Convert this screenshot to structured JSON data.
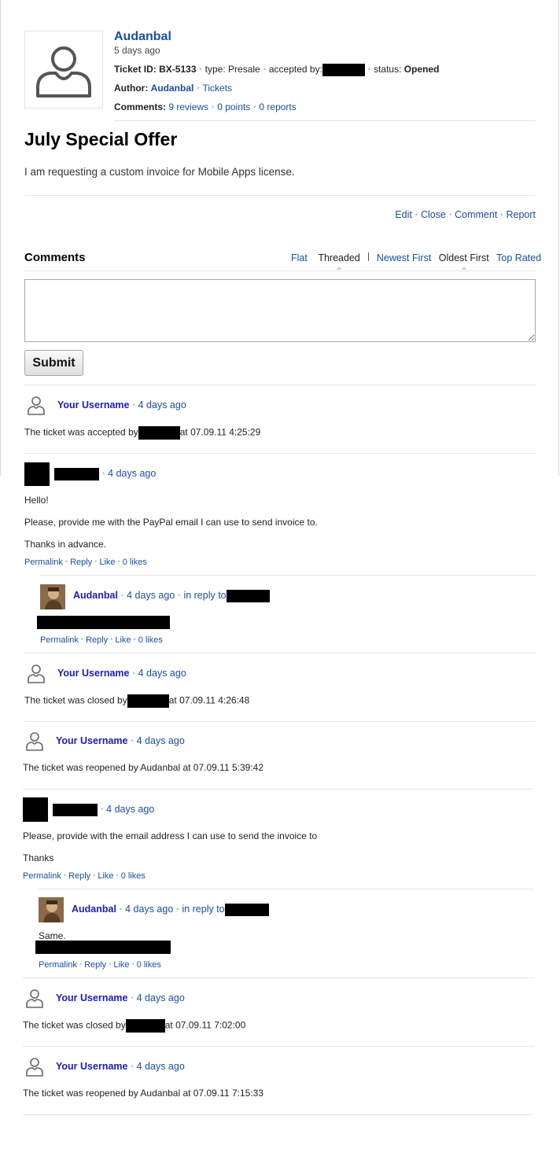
{
  "ticket": {
    "author": "Audanbal",
    "time": "5 days ago",
    "id_label": "Ticket ID:",
    "id": "BX-5133",
    "type_label": "type:",
    "type": "Presale",
    "accepted_label": "accepted by:",
    "status_label": "status:",
    "status": "Opened",
    "author_label": "Author:",
    "author_link": "Audanbal",
    "tickets_link": "Tickets",
    "comments_label": "Comments:",
    "reviews": "9 reviews",
    "points": "0 points",
    "reports": "0 reports",
    "title": "July Special Offer",
    "body": "I am requesting a custom invoice for Mobile Apps license.",
    "actions": [
      "Edit",
      "Close",
      "Comment",
      "Report"
    ]
  },
  "comments_section": {
    "title": "Comments",
    "view_flat": "Flat",
    "view_threaded": "Threaded",
    "sort_newest": "Newest First",
    "sort_oldest": "Oldest First",
    "sort_top": "Top Rated",
    "submit_label": "Submit"
  },
  "common": {
    "your_username": "Your Username",
    "four_days": "4 days ago",
    "permalink": "Permalink",
    "reply": "Reply",
    "like": "Like",
    "likes": "0 likes",
    "in_reply_to": "in reply to",
    "audanbal": "Audanbal"
  },
  "comments": {
    "c1_text_a": "The ticket was accepted by",
    "c1_text_b": "at 07.09.11 4:25:29",
    "c2_l1": "Hello!",
    "c2_l2": "Please, provide me with the PayPal email I can use to send invoice to.",
    "c2_l3": "Thanks in advance.",
    "c4_text_a": "The ticket was closed by",
    "c4_text_b": "at 07.09.11 4:26:48",
    "c5_text": "The ticket was reopened by Audanbal at 07.09.11 5:39:42",
    "c6_l1": "Please, provide with the email address I can use to send the invoice to",
    "c6_l2": "Thanks",
    "c7_text": "Same.",
    "c8_text_a": "The ticket was closed by",
    "c8_text_b": "at 07.09.11 7:02:00",
    "c9_text": "The ticket was reopened by Audanbal at 07.09.11 7:15:33"
  }
}
